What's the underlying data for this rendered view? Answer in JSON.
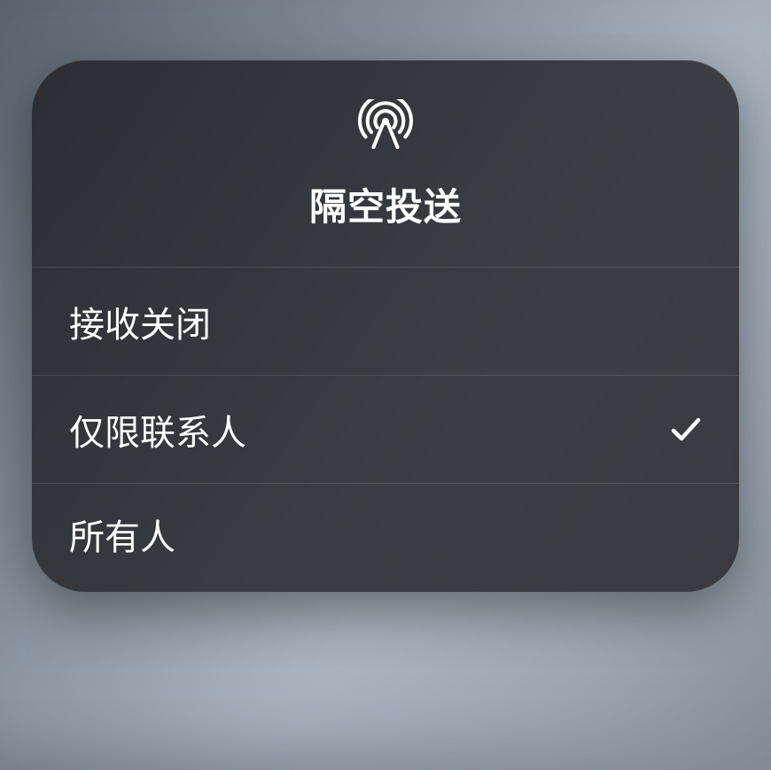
{
  "panel": {
    "title": "隔空投送",
    "options": [
      {
        "label": "接收关闭",
        "selected": false
      },
      {
        "label": "仅限联系人",
        "selected": true
      },
      {
        "label": "所有人",
        "selected": false
      }
    ]
  }
}
